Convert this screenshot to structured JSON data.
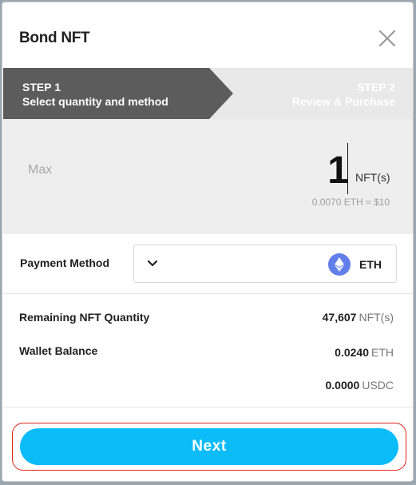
{
  "modal": {
    "title": "Bond NFT"
  },
  "steps": {
    "step1": {
      "number": "STEP 1",
      "label": "Select quantity and method"
    },
    "step2": {
      "number": "STEP 2",
      "label": "Review & Purchase"
    }
  },
  "quantity": {
    "max_label": "Max",
    "value": "1",
    "unit": "NFT(s)",
    "price": "0.0070 ETH ≈ $10"
  },
  "payment": {
    "label": "Payment Method",
    "selected": "ETH"
  },
  "info": {
    "remaining_label": "Remaining NFT Quantity",
    "remaining_value": "47,607",
    "remaining_unit": "NFT(s)",
    "wallet_label": "Wallet Balance",
    "wallet_eth_value": "0.0240",
    "wallet_eth_unit": "ETH",
    "wallet_usdc_value": "0.0000",
    "wallet_usdc_unit": "USDC"
  },
  "actions": {
    "next_label": "Next"
  },
  "colors": {
    "accent": "#0bbcf9",
    "step_active": "#5c5c5c",
    "step_inactive": "#e9e9e9",
    "highlight": "#e0241b",
    "eth": "#627eea"
  },
  "icons": {
    "close": "close-icon",
    "chevron": "chevron-down-icon",
    "eth": "ethereum-icon"
  }
}
